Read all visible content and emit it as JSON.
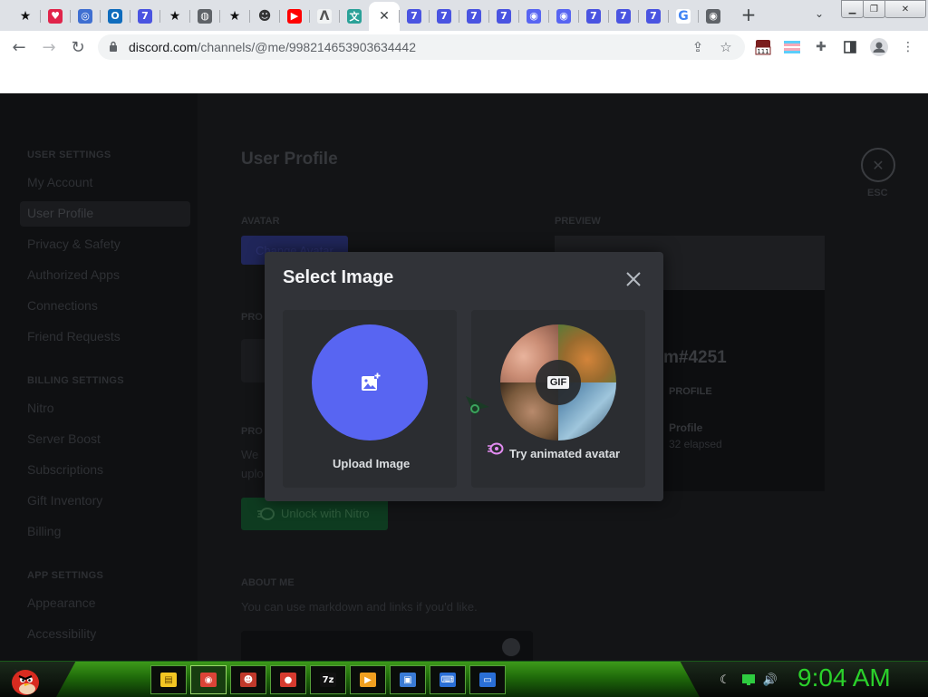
{
  "browser": {
    "tabs": [
      {
        "icon": "star-black-icon",
        "bg": "#dee1e6",
        "fg": "#111",
        "glyph": "★"
      },
      {
        "icon": "pocket-icon",
        "bg": "#e0244a",
        "fg": "#fff",
        "glyph": "♥"
      },
      {
        "icon": "circle-app-icon",
        "bg": "#3f6fd1",
        "fg": "#fff",
        "glyph": "◎"
      },
      {
        "icon": "outlook-icon",
        "bg": "#0f6cbd",
        "fg": "#fff",
        "glyph": "O"
      },
      {
        "icon": "app-7-icon",
        "bg": "#4a54e1",
        "fg": "#fff",
        "glyph": "7"
      },
      {
        "icon": "star-black-icon",
        "bg": "#dee1e6",
        "fg": "#111",
        "glyph": "★"
      },
      {
        "icon": "globe-icon",
        "bg": "#5f6368",
        "fg": "#fff",
        "glyph": "◍"
      },
      {
        "icon": "star-black-icon",
        "bg": "#dee1e6",
        "fg": "#111",
        "glyph": "★"
      },
      {
        "icon": "raccoon-icon",
        "bg": "#dee1e6",
        "fg": "#333",
        "glyph": "☻"
      },
      {
        "icon": "youtube-icon",
        "bg": "#ff0000",
        "fg": "#fff",
        "glyph": "▶"
      },
      {
        "icon": "lambda-icon",
        "bg": "#f1f3f4",
        "fg": "#555",
        "glyph": "Λ"
      },
      {
        "icon": "translate-icon",
        "bg": "#2aa198",
        "fg": "#fff",
        "glyph": "文"
      },
      {
        "icon": "close-tab-icon",
        "bg": "#ffffff",
        "fg": "#3c4043",
        "glyph": "✕"
      },
      {
        "icon": "app-7-icon",
        "bg": "#4a54e1",
        "fg": "#fff",
        "glyph": "7"
      },
      {
        "icon": "app-7-icon",
        "bg": "#4a54e1",
        "fg": "#fff",
        "glyph": "7"
      },
      {
        "icon": "app-7-icon",
        "bg": "#4a54e1",
        "fg": "#fff",
        "glyph": "7"
      },
      {
        "icon": "app-7-icon",
        "bg": "#4a54e1",
        "fg": "#fff",
        "glyph": "7"
      },
      {
        "icon": "discord-icon",
        "bg": "#5865f2",
        "fg": "#fff",
        "glyph": "◉"
      },
      {
        "icon": "discord-icon",
        "bg": "#5865f2",
        "fg": "#fff",
        "glyph": "◉"
      },
      {
        "icon": "app-7-icon",
        "bg": "#4a54e1",
        "fg": "#fff",
        "glyph": "7"
      },
      {
        "icon": "app-7-icon",
        "bg": "#4a54e1",
        "fg": "#fff",
        "glyph": "7"
      },
      {
        "icon": "app-7-icon",
        "bg": "#4a54e1",
        "fg": "#fff",
        "glyph": "7"
      },
      {
        "icon": "google-icon",
        "bg": "#ffffff",
        "fg": "#4285f4",
        "glyph": "G"
      },
      {
        "icon": "chrome-web-icon",
        "bg": "#5f6368",
        "fg": "#fff",
        "glyph": "◉"
      }
    ],
    "url_host": "discord.com",
    "url_path": "/channels/@me/998214653903634442",
    "ext_badge": "111"
  },
  "discord": {
    "user_settings_head": "USER SETTINGS",
    "user_items": [
      "My Account",
      "User Profile",
      "Privacy & Safety",
      "Authorized Apps",
      "Connections",
      "Friend Requests"
    ],
    "billing_head": "BILLING SETTINGS",
    "billing_items": [
      "Nitro",
      "Server Boost",
      "Subscriptions",
      "Gift Inventory",
      "Billing"
    ],
    "app_head": "APP SETTINGS",
    "app_items": [
      "Appearance",
      "Accessibility"
    ],
    "page_title": "User Profile",
    "avatar_label": "AVATAR",
    "change_avatar": "Change Avatar",
    "preview_label": "PREVIEW",
    "profile_color_label": "PRO",
    "profile_label_2": "PRO",
    "dim_we": "We",
    "dim_uplo": "uplo",
    "unlock_nitro": "Unlock with Nitro",
    "about_me_label": "ABOUT ME",
    "about_me_hint": "You can use markdown and links if you'd like.",
    "preview_tag": "m#4251",
    "preview_button": "PROFILE",
    "preview_activity": "Profile",
    "preview_elapsed": "32 elapsed",
    "esc_label": "ESC"
  },
  "modal": {
    "title": "Select Image",
    "upload_label": "Upload Image",
    "animated_label": "Try animated avatar",
    "gif_badge": "GIF"
  },
  "taskbar": {
    "clock": "9:04 AM",
    "items": [
      {
        "icon": "file-explorer-icon",
        "bg": "#f3c623",
        "fg": "#6b4a00",
        "glyph": "▤",
        "active": false
      },
      {
        "icon": "chrome-icon",
        "bg": "#db4437",
        "fg": "#fff",
        "glyph": "◉",
        "active": true
      },
      {
        "icon": "game-character-icon",
        "bg": "#c0392b",
        "fg": "#fff",
        "glyph": "☻",
        "active": false
      },
      {
        "icon": "angry-bird-icon",
        "bg": "#d63b2f",
        "fg": "#fff",
        "glyph": "●",
        "active": false
      },
      {
        "icon": "7zip-icon",
        "bg": "#111111",
        "fg": "#fff",
        "glyph": "7z",
        "active": false
      },
      {
        "icon": "media-player-icon",
        "bg": "#f0a020",
        "fg": "#fff",
        "glyph": "▶",
        "active": false
      },
      {
        "icon": "remote-desktop-icon",
        "bg": "#3a7bd5",
        "fg": "#fff",
        "glyph": "▣",
        "active": false
      },
      {
        "icon": "keyboard-icon",
        "bg": "#2a6fd6",
        "fg": "#fff",
        "glyph": "⌨",
        "active": false
      },
      {
        "icon": "window-app-icon",
        "bg": "#2a6fd6",
        "fg": "#fff",
        "glyph": "▭",
        "active": false
      }
    ]
  }
}
